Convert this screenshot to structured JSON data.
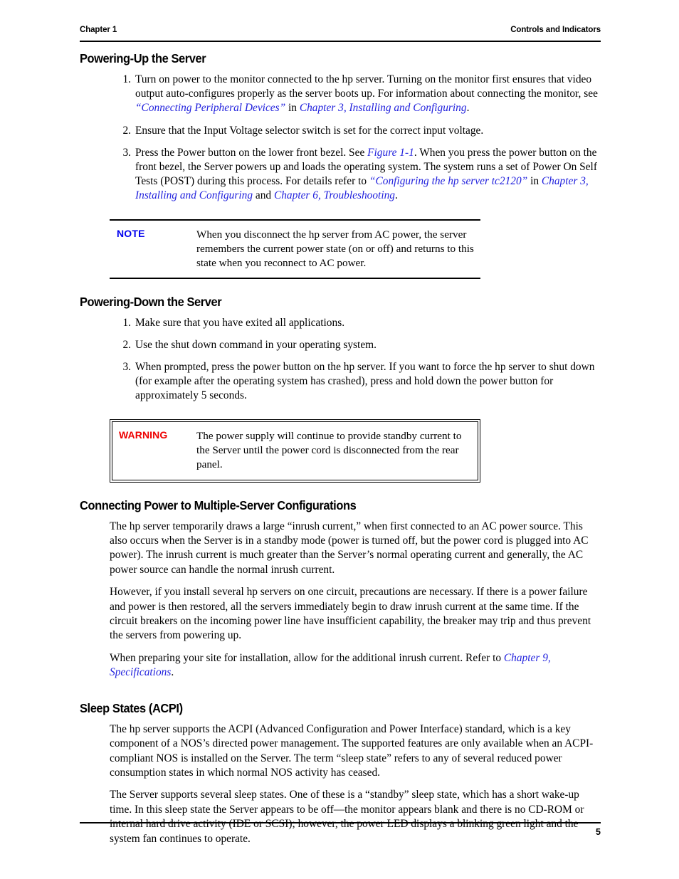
{
  "header": {
    "left": "Chapter 1",
    "right": "Controls and Indicators"
  },
  "footer": {
    "page_number": "5"
  },
  "colors": {
    "xref": "#2222dd",
    "note_label": "#0000ee",
    "warning_label": "#ee0000",
    "text": "#000000",
    "page_background": "#ffffff"
  },
  "sections": {
    "powering_up": {
      "heading": "Powering-Up the Server",
      "steps": [
        {
          "num": "1.",
          "parts": [
            {
              "type": "text",
              "value": "Turn on power to the monitor connected to the hp server. Turning on the monitor first ensures that video output auto-configures properly as the server boots up. For information about connecting the monitor, see "
            },
            {
              "type": "xref",
              "value": "“Connecting Peripheral Devices”"
            },
            {
              "type": "text",
              "value": " in "
            },
            {
              "type": "xref",
              "value": "Chapter 3, Installing and Configuring"
            },
            {
              "type": "text",
              "value": "."
            }
          ]
        },
        {
          "num": "2.",
          "parts": [
            {
              "type": "text",
              "value": "Ensure that the Input Voltage selector switch is set for the correct input voltage."
            }
          ]
        },
        {
          "num": "3.",
          "parts": [
            {
              "type": "text",
              "value": "Press the Power button on the lower front bezel. See "
            },
            {
              "type": "xref",
              "value": "Figure 1-1"
            },
            {
              "type": "text",
              "value": ". When you press the power button on the front bezel, the Server powers up and loads the operating system. The system runs a set of Power On Self Tests (POST) during this process. For details refer to "
            },
            {
              "type": "xref",
              "value": "“Configuring the hp server tc2120”"
            },
            {
              "type": "text",
              "value": " in "
            },
            {
              "type": "xref",
              "value": "Chapter 3, Installing and Configuring"
            },
            {
              "type": "text",
              "value": " and "
            },
            {
              "type": "xref",
              "value": "Chapter 6, Troubleshooting"
            },
            {
              "type": "text",
              "value": "."
            }
          ]
        }
      ],
      "note": {
        "label": "NOTE",
        "text": "When you disconnect the hp server from AC power, the server remembers the current power state (on or off) and returns to this state when you reconnect to AC power."
      }
    },
    "powering_down": {
      "heading": "Powering-Down the Server",
      "steps": [
        {
          "num": "1.",
          "parts": [
            {
              "type": "text",
              "value": "Make sure that you have exited all applications."
            }
          ]
        },
        {
          "num": "2.",
          "parts": [
            {
              "type": "text",
              "value": "Use the shut down command in your operating system."
            }
          ]
        },
        {
          "num": "3.",
          "parts": [
            {
              "type": "text",
              "value": "When prompted, press the power button on the hp server. If you want to force the hp server to shut down (for example after the operating system has crashed), press and hold down the power button for approximately 5 seconds."
            }
          ]
        }
      ],
      "warning": {
        "label": "WARNING",
        "text": "The power supply will continue to provide standby current to the Server until the power cord is disconnected from the rear panel."
      }
    },
    "connecting_power": {
      "heading": "Connecting Power to Multiple-Server Configurations",
      "paragraphs": [
        {
          "parts": [
            {
              "type": "text",
              "value": "The hp server temporarily draws a large “inrush current,” when first connected to an AC power source. This also occurs when the Server is in a standby mode (power is turned off, but the power cord is plugged into AC power). The inrush current is much greater than the Server’s normal operating current and generally, the AC power source can handle the normal inrush current."
            }
          ]
        },
        {
          "parts": [
            {
              "type": "text",
              "value": "However, if you install several hp servers on one circuit, precautions are necessary. If there is a power failure and power is then restored, all the servers immediately begin to draw inrush current at the same time. If the circuit breakers on the incoming power line have insufficient capability, the breaker may trip and thus prevent the servers from powering up."
            }
          ]
        },
        {
          "parts": [
            {
              "type": "text",
              "value": "When preparing your site for installation, allow for the additional inrush current. Refer to "
            },
            {
              "type": "xref",
              "value": "Chapter 9, Specifications"
            },
            {
              "type": "text",
              "value": "."
            }
          ]
        }
      ]
    },
    "sleep_states": {
      "heading": "Sleep States (ACPI)",
      "paragraphs": [
        {
          "parts": [
            {
              "type": "text",
              "value": "The hp server supports the ACPI (Advanced Configuration and Power Interface) standard, which is a key component of a NOS’s directed power management. The supported features are only available when an ACPI-compliant NOS is installed on the Server. The term “sleep state” refers to any of several reduced power consumption states in which normal NOS activity has ceased."
            }
          ]
        },
        {
          "parts": [
            {
              "type": "text",
              "value": "The Server supports several sleep states. One of these is a “standby” sleep state, which has a short wake-up time. In this sleep state the Server appears to be off—the monitor appears blank and there is no CD-ROM or internal hard drive activity (IDE or SCSI); however, the power LED displays a blinking green light and the system fan continues to operate."
            }
          ]
        }
      ]
    }
  }
}
